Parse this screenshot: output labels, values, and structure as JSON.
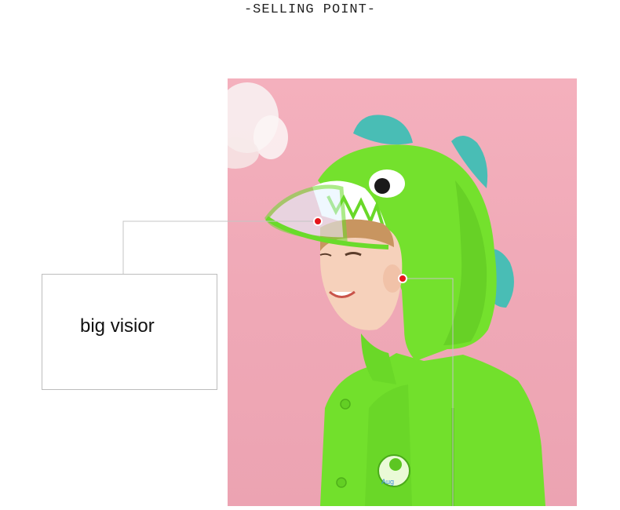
{
  "header": {
    "title": "-SELLING POINT-"
  },
  "photo": {
    "colors": {
      "background": "#f0a9b7",
      "raincoat": "#6fe02a",
      "spikes": "#49bdb5",
      "visor": "#dff3ff"
    },
    "badge_text": "Aug"
  },
  "callout": {
    "label": "big visior",
    "marker_color": "#e5161b"
  }
}
